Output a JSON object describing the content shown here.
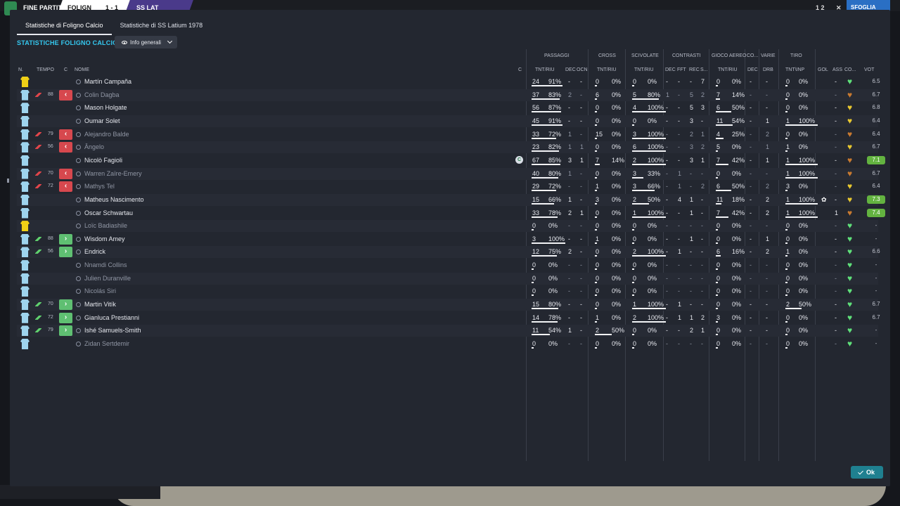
{
  "topbar": {
    "home_label": "FINE PARTITA",
    "team_home": "FOLIGN",
    "score": "1 - 1",
    "team_away": "SS LAT",
    "right_score": "1 2",
    "right_x": "✕",
    "right_button": "SFOGLIA TUTTO"
  },
  "tabs": [
    {
      "label": "Statistiche di Foligno Calcio",
      "active": true
    },
    {
      "label": "Statistiche di SS Latium 1978",
      "active": false
    }
  ],
  "section_title": "STATISTICHE FOLIGNO CALCIO",
  "view_selector": {
    "label": "Info generali"
  },
  "groups": {
    "passes": "PASSAGGI",
    "cross": "CROSS",
    "tackles": "SCIVOLATE",
    "contrasts": "CONTRASTI",
    "aerial": "GIOCO AEREO",
    "co": "CO...",
    "misc": "VARIE",
    "shot": "TIRO"
  },
  "columns": {
    "num": "N.",
    "time": "TEMPO",
    "c": "C",
    "name": "NOME",
    "c2": "C",
    "pass_tnt": "TNT/RIU",
    "pass_dec": "DEC",
    "pass_ocn": "OCN",
    "cross_tnt": "TNT/RIU",
    "tackle_tnt": "TNT/RIU",
    "con_dec": "DEC",
    "con_fft": "FFT",
    "con_rec": "REC",
    "con_s": "S...",
    "aer_tnt": "TNT/RIU",
    "co_dec": "DEC",
    "drb": "DRB",
    "shot_tnt": "TNT\\INP",
    "gol": "GOL",
    "ass": "ASS",
    "co2": "CO...",
    "vot": "VOT"
  },
  "players": [
    {
      "gk": true,
      "sub": "",
      "min": "",
      "name": "Martín Campaña",
      "dim": false,
      "capt": false,
      "p": [
        "24",
        "91%"
      ],
      "pd": "-",
      "po": "-",
      "cr": [
        "0",
        "0%"
      ],
      "tk": [
        "0",
        "0%"
      ],
      "cd": "-",
      "cf": "-",
      "cre": "-",
      "cs": "7",
      "ae": [
        "0",
        "0%"
      ],
      "cod": "-",
      "drb": "-",
      "sh": [
        "0",
        "0%"
      ],
      "gol": "",
      "ass": "-",
      "star": false,
      "heart": "g",
      "vot": "6.5",
      "hl": false
    },
    {
      "gk": false,
      "sub": "out",
      "min": "88",
      "name": "Colin Dagba",
      "dim": true,
      "capt": false,
      "p": [
        "37",
        "83%"
      ],
      "pd": "2",
      "po": "-",
      "cr": [
        "6",
        "0%"
      ],
      "tk": [
        "5",
        "80%"
      ],
      "cd": "1",
      "cf": "-",
      "cre": "5",
      "cs": "2",
      "ae": [
        "7",
        "14%"
      ],
      "cod": "-",
      "drb": "-",
      "sh": [
        "0",
        "0%"
      ],
      "gol": "",
      "ass": "-",
      "star": false,
      "heart": "o",
      "vot": "6.7",
      "hl": false
    },
    {
      "gk": false,
      "sub": "",
      "min": "",
      "name": "Mason Holgate",
      "dim": false,
      "capt": false,
      "p": [
        "56",
        "87%"
      ],
      "pd": "-",
      "po": "-",
      "cr": [
        "0",
        "0%"
      ],
      "tk": [
        "4",
        "100%"
      ],
      "cd": "-",
      "cf": "-",
      "cre": "5",
      "cs": "3",
      "ae": [
        "6",
        "50%"
      ],
      "cod": "-",
      "drb": "-",
      "sh": [
        "0",
        "0%"
      ],
      "gol": "",
      "ass": "-",
      "star": false,
      "heart": "y",
      "vot": "6.8",
      "hl": false
    },
    {
      "gk": false,
      "sub": "",
      "min": "",
      "name": "Oumar Solet",
      "dim": false,
      "capt": false,
      "p": [
        "45",
        "91%"
      ],
      "pd": "-",
      "po": "-",
      "cr": [
        "0",
        "0%"
      ],
      "tk": [
        "0",
        "0%"
      ],
      "cd": "-",
      "cf": "-",
      "cre": "3",
      "cs": "-",
      "ae": [
        "11",
        "54%"
      ],
      "cod": "-",
      "drb": "1",
      "sh": [
        "1",
        "100%"
      ],
      "gol": "",
      "ass": "-",
      "star": false,
      "heart": "y",
      "vot": "6.4",
      "hl": false
    },
    {
      "gk": false,
      "sub": "out",
      "min": "79",
      "name": "Alejandro Balde",
      "dim": true,
      "capt": false,
      "p": [
        "33",
        "72%"
      ],
      "pd": "1",
      "po": "-",
      "cr": [
        "15",
        "0%"
      ],
      "tk": [
        "3",
        "100%"
      ],
      "cd": "-",
      "cf": "-",
      "cre": "2",
      "cs": "1",
      "ae": [
        "4",
        "25%"
      ],
      "cod": "-",
      "drb": "2",
      "sh": [
        "0",
        "0%"
      ],
      "gol": "",
      "ass": "-",
      "star": false,
      "heart": "o",
      "vot": "6.4",
      "hl": false
    },
    {
      "gk": false,
      "sub": "out",
      "min": "56",
      "name": "Ângelo",
      "dim": true,
      "capt": false,
      "p": [
        "23",
        "82%"
      ],
      "pd": "1",
      "po": "1",
      "cr": [
        "0",
        "0%"
      ],
      "tk": [
        "6",
        "100%"
      ],
      "cd": "-",
      "cf": "-",
      "cre": "3",
      "cs": "2",
      "ae": [
        "5",
        "0%"
      ],
      "cod": "-",
      "drb": "1",
      "sh": [
        "1",
        "0%"
      ],
      "gol": "",
      "ass": "-",
      "star": false,
      "heart": "y",
      "vot": "6.7",
      "hl": false
    },
    {
      "gk": false,
      "sub": "",
      "min": "",
      "name": "Nicolò Fagioli",
      "dim": false,
      "capt": true,
      "p": [
        "67",
        "85%"
      ],
      "pd": "3",
      "po": "1",
      "cr": [
        "7",
        "14%"
      ],
      "tk": [
        "2",
        "100%"
      ],
      "cd": "-",
      "cf": "-",
      "cre": "3",
      "cs": "1",
      "ae": [
        "7",
        "42%"
      ],
      "cod": "-",
      "drb": "1",
      "sh": [
        "1",
        "100%"
      ],
      "gol": "",
      "ass": "-",
      "star": false,
      "heart": "o",
      "vot": "7.1",
      "hl": true
    },
    {
      "gk": false,
      "sub": "out",
      "min": "70",
      "name": "Warren Zaïre-Emery",
      "dim": true,
      "capt": false,
      "p": [
        "40",
        "80%"
      ],
      "pd": "1",
      "po": "-",
      "cr": [
        "0",
        "0%"
      ],
      "tk": [
        "3",
        "33%"
      ],
      "cd": "-",
      "cf": "1",
      "cre": "-",
      "cs": "-",
      "ae": [
        "0",
        "0%"
      ],
      "cod": "-",
      "drb": "-",
      "sh": [
        "1",
        "100%"
      ],
      "gol": "",
      "ass": "-",
      "star": false,
      "heart": "o",
      "vot": "6.7",
      "hl": false
    },
    {
      "gk": false,
      "sub": "out",
      "min": "72",
      "name": "Mathys Tel",
      "dim": true,
      "capt": false,
      "p": [
        "29",
        "72%"
      ],
      "pd": "-",
      "po": "-",
      "cr": [
        "1",
        "0%"
      ],
      "tk": [
        "3",
        "66%"
      ],
      "cd": "-",
      "cf": "1",
      "cre": "-",
      "cs": "2",
      "ae": [
        "6",
        "50%"
      ],
      "cod": "-",
      "drb": "2",
      "sh": [
        "3",
        "0%"
      ],
      "gol": "",
      "ass": "-",
      "star": false,
      "heart": "y",
      "vot": "6.4",
      "hl": false
    },
    {
      "gk": false,
      "sub": "",
      "min": "",
      "name": "Matheus Nascimento",
      "dim": false,
      "capt": false,
      "p": [
        "15",
        "66%"
      ],
      "pd": "1",
      "po": "-",
      "cr": [
        "3",
        "0%"
      ],
      "tk": [
        "2",
        "50%"
      ],
      "cd": "-",
      "cf": "4",
      "cre": "1",
      "cs": "-",
      "ae": [
        "11",
        "18%"
      ],
      "cod": "-",
      "drb": "2",
      "sh": [
        "1",
        "100%"
      ],
      "gol": "",
      "ass": "-",
      "star": true,
      "heart": "y",
      "vot": "7.3",
      "hl": true
    },
    {
      "gk": false,
      "sub": "",
      "min": "",
      "name": "Oscar Schwartau",
      "dim": false,
      "capt": false,
      "p": [
        "33",
        "78%"
      ],
      "pd": "2",
      "po": "1",
      "cr": [
        "0",
        "0%"
      ],
      "tk": [
        "1",
        "100%"
      ],
      "cd": "-",
      "cf": "-",
      "cre": "1",
      "cs": "-",
      "ae": [
        "7",
        "42%"
      ],
      "cod": "-",
      "drb": "2",
      "sh": [
        "1",
        "100%"
      ],
      "gol": "",
      "ass": "1",
      "star": false,
      "heart": "o",
      "vot": "7.4",
      "hl": true
    },
    {
      "gk": true,
      "sub": "",
      "min": "",
      "name": "Loïc Badiashile",
      "dim": true,
      "capt": false,
      "p": [
        "0",
        "0%"
      ],
      "pd": "-",
      "po": "-",
      "cr": [
        "0",
        "0%"
      ],
      "tk": [
        "0",
        "0%"
      ],
      "cd": "-",
      "cf": "-",
      "cre": "-",
      "cs": "-",
      "ae": [
        "0",
        "0%"
      ],
      "cod": "-",
      "drb": "-",
      "sh": [
        "0",
        "0%"
      ],
      "gol": "",
      "ass": "-",
      "star": false,
      "heart": "g",
      "vot": "-",
      "hl": false
    },
    {
      "gk": false,
      "sub": "in",
      "min": "88",
      "name": "Wisdom Amey",
      "dim": false,
      "capt": false,
      "p": [
        "3",
        "100%"
      ],
      "pd": "-",
      "po": "-",
      "cr": [
        "1",
        "0%"
      ],
      "tk": [
        "0",
        "0%"
      ],
      "cd": "-",
      "cf": "-",
      "cre": "1",
      "cs": "-",
      "ae": [
        "0",
        "0%"
      ],
      "cod": "-",
      "drb": "1",
      "sh": [
        "0",
        "0%"
      ],
      "gol": "",
      "ass": "-",
      "star": false,
      "heart": "g",
      "vot": "-",
      "hl": false
    },
    {
      "gk": false,
      "sub": "in",
      "min": "56",
      "name": "Endrick",
      "dim": false,
      "capt": false,
      "p": [
        "12",
        "75%"
      ],
      "pd": "2",
      "po": "-",
      "cr": [
        "0",
        "0%"
      ],
      "tk": [
        "2",
        "100%"
      ],
      "cd": "-",
      "cf": "1",
      "cre": "-",
      "cs": "-",
      "ae": [
        "6",
        "16%"
      ],
      "cod": "-",
      "drb": "2",
      "sh": [
        "1",
        "0%"
      ],
      "gol": "",
      "ass": "-",
      "star": false,
      "heart": "g",
      "vot": "6.6",
      "hl": false
    },
    {
      "gk": false,
      "sub": "",
      "min": "",
      "name": "Nnamdi Collins",
      "dim": true,
      "capt": false,
      "p": [
        "0",
        "0%"
      ],
      "pd": "-",
      "po": "-",
      "cr": [
        "0",
        "0%"
      ],
      "tk": [
        "0",
        "0%"
      ],
      "cd": "-",
      "cf": "-",
      "cre": "-",
      "cs": "-",
      "ae": [
        "0",
        "0%"
      ],
      "cod": "-",
      "drb": "-",
      "sh": [
        "0",
        "0%"
      ],
      "gol": "",
      "ass": "-",
      "star": false,
      "heart": "g",
      "vot": "-",
      "hl": false
    },
    {
      "gk": false,
      "sub": "",
      "min": "",
      "name": "Julien Duranville",
      "dim": true,
      "capt": false,
      "p": [
        "0",
        "0%"
      ],
      "pd": "-",
      "po": "-",
      "cr": [
        "0",
        "0%"
      ],
      "tk": [
        "0",
        "0%"
      ],
      "cd": "-",
      "cf": "-",
      "cre": "-",
      "cs": "-",
      "ae": [
        "0",
        "0%"
      ],
      "cod": "-",
      "drb": "-",
      "sh": [
        "0",
        "0%"
      ],
      "gol": "",
      "ass": "-",
      "star": false,
      "heart": "g",
      "vot": "-",
      "hl": false
    },
    {
      "gk": false,
      "sub": "",
      "min": "",
      "name": "Nicolás Siri",
      "dim": true,
      "capt": false,
      "p": [
        "0",
        "0%"
      ],
      "pd": "-",
      "po": "-",
      "cr": [
        "0",
        "0%"
      ],
      "tk": [
        "0",
        "0%"
      ],
      "cd": "-",
      "cf": "-",
      "cre": "-",
      "cs": "-",
      "ae": [
        "0",
        "0%"
      ],
      "cod": "-",
      "drb": "-",
      "sh": [
        "0",
        "0%"
      ],
      "gol": "",
      "ass": "-",
      "star": false,
      "heart": "g",
      "vot": "-",
      "hl": false
    },
    {
      "gk": false,
      "sub": "in",
      "min": "70",
      "name": "Martin Vitík",
      "dim": false,
      "capt": false,
      "p": [
        "15",
        "80%"
      ],
      "pd": "-",
      "po": "-",
      "cr": [
        "0",
        "0%"
      ],
      "tk": [
        "1",
        "100%"
      ],
      "cd": "-",
      "cf": "1",
      "cre": "-",
      "cs": "-",
      "ae": [
        "0",
        "0%"
      ],
      "cod": "-",
      "drb": "-",
      "sh": [
        "2",
        "50%"
      ],
      "gol": "",
      "ass": "-",
      "star": false,
      "heart": "g",
      "vot": "6.7",
      "hl": false
    },
    {
      "gk": false,
      "sub": "in",
      "min": "72",
      "name": "Gianluca Prestianni",
      "dim": false,
      "capt": false,
      "p": [
        "14",
        "78%"
      ],
      "pd": "-",
      "po": "-",
      "cr": [
        "1",
        "0%"
      ],
      "tk": [
        "2",
        "100%"
      ],
      "cd": "-",
      "cf": "1",
      "cre": "1",
      "cs": "2",
      "ae": [
        "3",
        "0%"
      ],
      "cod": "-",
      "drb": "-",
      "sh": [
        "0",
        "0%"
      ],
      "gol": "",
      "ass": "-",
      "star": false,
      "heart": "g",
      "vot": "6.7",
      "hl": false
    },
    {
      "gk": false,
      "sub": "in",
      "min": "79",
      "name": "Ishé Samuels-Smith",
      "dim": false,
      "capt": false,
      "p": [
        "11",
        "54%"
      ],
      "pd": "1",
      "po": "-",
      "cr": [
        "2",
        "50%"
      ],
      "tk": [
        "0",
        "0%"
      ],
      "cd": "-",
      "cf": "-",
      "cre": "2",
      "cs": "1",
      "ae": [
        "0",
        "0%"
      ],
      "cod": "-",
      "drb": "-",
      "sh": [
        "0",
        "0%"
      ],
      "gol": "",
      "ass": "-",
      "star": false,
      "heart": "g",
      "vot": "-",
      "hl": false
    },
    {
      "gk": false,
      "sub": "",
      "min": "",
      "name": "Zidan Sertdemir",
      "dim": true,
      "capt": false,
      "p": [
        "0",
        "0%"
      ],
      "pd": "-",
      "po": "-",
      "cr": [
        "0",
        "0%"
      ],
      "tk": [
        "0",
        "0%"
      ],
      "cd": "-",
      "cf": "-",
      "cre": "-",
      "cs": "-",
      "ae": [
        "0",
        "0%"
      ],
      "cod": "-",
      "drb": "-",
      "sh": [
        "0",
        "0%"
      ],
      "gol": "",
      "ass": "-",
      "star": false,
      "heart": "g",
      "vot": "-",
      "hl": false
    }
  ],
  "captain_badge": "C",
  "ok_button": {
    "label": "Ok"
  }
}
